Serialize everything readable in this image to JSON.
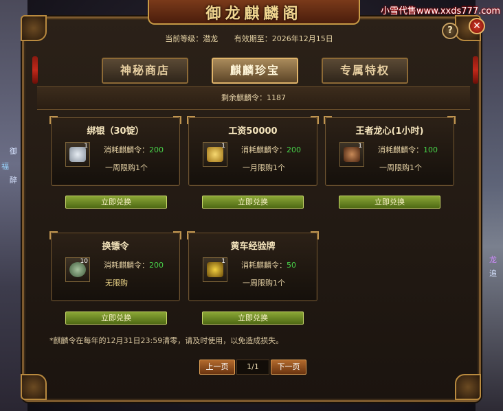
{
  "window_title": "御龙麒麟阁",
  "watermark": "小雪代售www.xxds777.com",
  "background_labels": [
    "御",
    "福",
    "醉",
    "龙",
    "追"
  ],
  "help_label": "?",
  "close_label": "✕",
  "info": {
    "level": "当前等级：潜龙",
    "expiry": "有效期至：2026年12月15日"
  },
  "tabs": [
    {
      "label": "神秘商店",
      "active": false
    },
    {
      "label": "麒麟珍宝",
      "active": true
    },
    {
      "label": "专属特权",
      "active": false
    }
  ],
  "remaining": "剩余麒麟令：1187",
  "items": [
    {
      "title": "绑银（30锭）",
      "qty": "1",
      "cost_label": "消耗麒麟令：",
      "cost": "200",
      "limit": "一周限购1个",
      "button": "立即兑换",
      "icon": "silver-ingot-icon",
      "color": "#b8c0c8"
    },
    {
      "title": "工资50000",
      "qty": "1",
      "cost_label": "消耗麒麟令：",
      "cost": "200",
      "limit": "一月限购1个",
      "button": "立即兑换",
      "icon": "gold-coins-icon",
      "color": "#d8a93a"
    },
    {
      "title": "王者龙心(1小时)",
      "qty": "1",
      "cost_label": "消耗麒麟令：",
      "cost": "100",
      "limit": "一周限购1个",
      "button": "立即兑换",
      "icon": "dragon-heart-icon",
      "color": "#7a4a2a"
    },
    {
      "title": "换镖令",
      "qty": "10",
      "cost_label": "消耗麒麟令：",
      "cost": "200",
      "limit": "无限购",
      "button": "立即兑换",
      "icon": "escort-token-icon",
      "color": "#6c8a6a"
    },
    {
      "title": "黄车经验牌",
      "qty": "1",
      "cost_label": "消耗麒麟令：",
      "cost": "50",
      "limit": "一周限购1个",
      "button": "立即兑换",
      "icon": "yellow-cart-icon",
      "color": "#c9a02a"
    }
  ],
  "footer_note": "*麒麟令在每年的12月31日23:59清零，请及时使用，以免造成损失。",
  "pager": {
    "prev": "上一页",
    "page": "1/1",
    "next": "下一页"
  }
}
